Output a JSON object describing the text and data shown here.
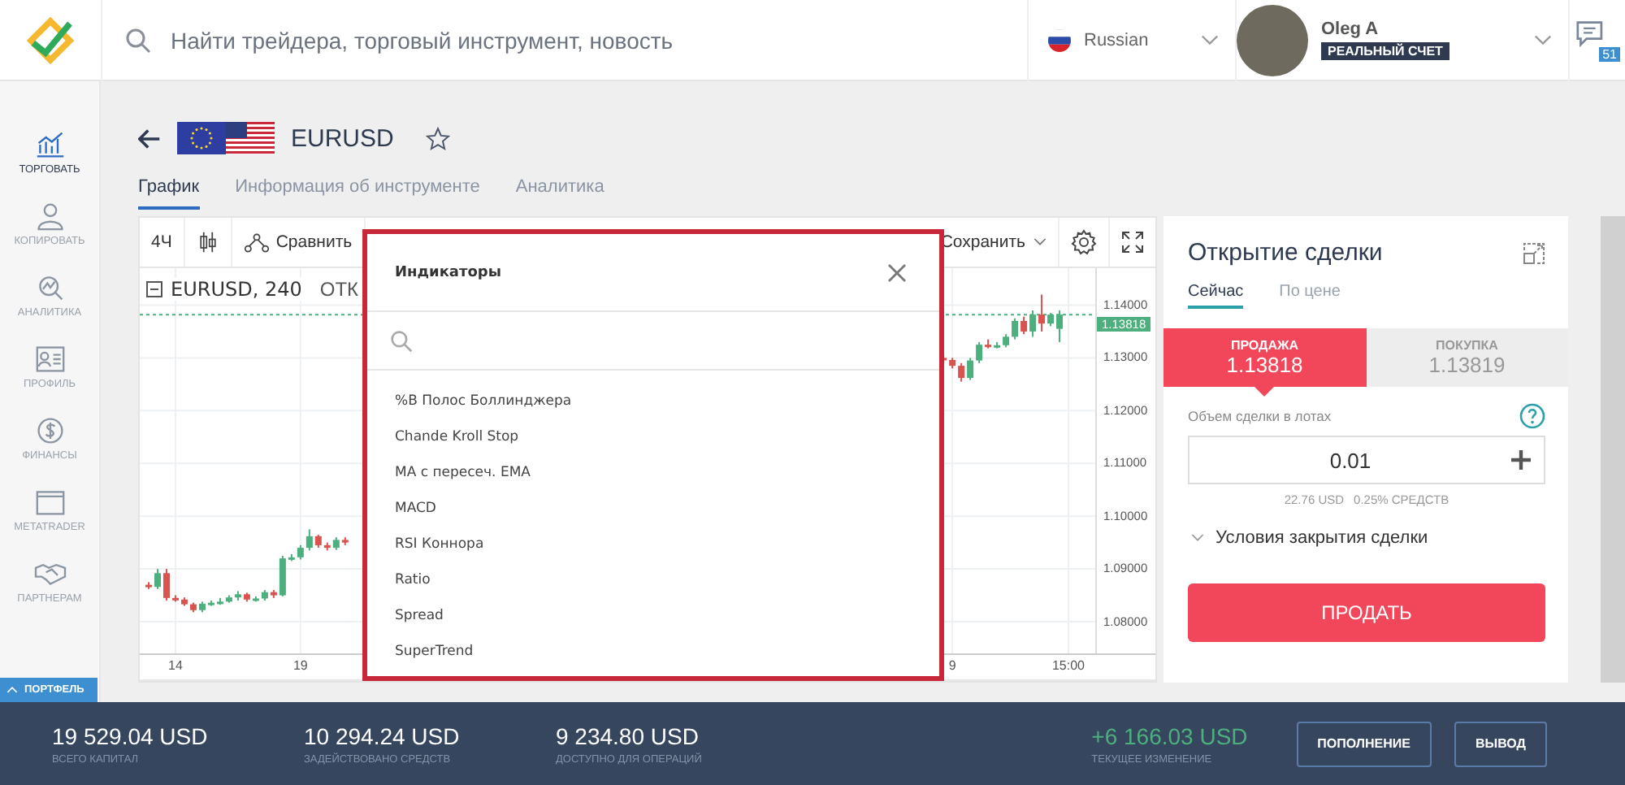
{
  "header": {
    "search": {
      "placeholder": "Найти трейдера, торговый инструмент, новость"
    },
    "language": "Russian",
    "user": {
      "name": "Oleg A",
      "account_badge": "РЕАЛЬНЫЙ СЧЕТ"
    },
    "messages_count": "51"
  },
  "sidebar": {
    "items": [
      {
        "label": "ТОРГОВАТЬ",
        "kind": "trade",
        "selected": true
      },
      {
        "label": "КОПИРОВАТЬ",
        "kind": "copy",
        "selected": false
      },
      {
        "label": "АНАЛИТИКА",
        "kind": "analytics",
        "selected": false
      },
      {
        "label": "ПРОФИЛЬ",
        "kind": "profile",
        "selected": false
      },
      {
        "label": "ФИНАНСЫ",
        "kind": "finance",
        "selected": false
      },
      {
        "label": "METATRADER",
        "kind": "window",
        "selected": false
      },
      {
        "label": "ПАРТНЕРАМ",
        "kind": "partners",
        "selected": false
      }
    ],
    "portfolio_tab": {
      "label": "ПОРТФЕЛЬ",
      "expanded": false
    }
  },
  "instrument": {
    "symbol": "EURUSD",
    "favorite": false
  },
  "tabs": [
    {
      "label": "График",
      "selected": true
    },
    {
      "label": "Информация об инструменте",
      "selected": false
    },
    {
      "label": "Аналитика",
      "selected": false
    }
  ],
  "chart": {
    "toolbar": {
      "interval": "4Ч",
      "compare": "Сравнить",
      "save": "Сохранить"
    },
    "legend": {
      "symbol": "EURUSD, 240",
      "extra": "ОТК"
    },
    "current_price": "1.13818",
    "chart_data": {
      "type": "candlestick",
      "ylim": [
        1.074,
        1.147
      ],
      "grid": true,
      "ref_lines": [
        {
          "axis": "y",
          "value": 1.13818
        }
      ],
      "yticks": [
        {
          "value": 1.14,
          "label": "1.14000"
        },
        {
          "value": 1.13,
          "label": "1.13000"
        },
        {
          "value": 1.12,
          "label": "1.12000"
        },
        {
          "value": 1.11,
          "label": "1.11000"
        },
        {
          "value": 1.1,
          "label": "1.10000"
        },
        {
          "value": 1.09,
          "label": "1.09000"
        },
        {
          "value": 1.08,
          "label": "1.08000"
        }
      ],
      "categories": [
        null,
        null,
        null,
        null,
        "14",
        null,
        null,
        null,
        null,
        null,
        null,
        null,
        null,
        null,
        null,
        null,
        null,
        null,
        "19",
        null,
        null,
        null,
        null,
        null,
        null,
        null,
        null,
        null,
        null,
        null,
        null,
        null,
        null,
        null,
        null,
        null,
        null,
        null,
        null,
        null,
        null,
        null,
        null,
        null,
        null,
        null,
        null,
        null,
        null,
        null,
        null,
        null,
        null,
        null,
        null,
        null,
        null,
        null,
        null,
        null,
        null,
        null,
        null,
        null,
        null,
        null,
        null,
        null,
        null,
        null,
        null,
        null,
        null,
        null,
        null,
        null,
        null,
        null,
        null,
        null,
        null,
        null,
        null,
        null,
        null,
        null,
        null,
        null,
        null,
        null,
        null,
        "9",
        null,
        null,
        null,
        null,
        null,
        null,
        null,
        null,
        null,
        null,
        null,
        null,
        "15:00",
        null,
        null
      ],
      "ohlc": [
        null,
        [
          1.087,
          1.0875,
          1.0862,
          1.0866
        ],
        [
          1.0866,
          1.09,
          1.0862,
          1.0892
        ],
        [
          1.0892,
          1.09,
          1.084,
          1.0845
        ],
        [
          1.0845,
          1.085,
          1.0838,
          1.0842
        ],
        [
          1.0842,
          1.0846,
          1.083,
          1.0833
        ],
        [
          1.0833,
          1.0836,
          1.0818,
          1.0822
        ],
        [
          1.0822,
          1.0838,
          1.0818,
          1.0834
        ],
        [
          1.0834,
          1.084,
          1.083,
          1.0836
        ],
        [
          1.0836,
          1.0845,
          1.0832,
          1.0838
        ],
        [
          1.0838,
          1.085,
          1.0836,
          1.0846
        ],
        [
          1.0846,
          1.0858,
          1.084,
          1.0852
        ],
        [
          1.0852,
          1.0855,
          1.0838,
          1.0842
        ],
        [
          1.0842,
          1.0848,
          1.0838,
          1.0844
        ],
        [
          1.0844,
          1.086,
          1.084,
          1.0856
        ],
        [
          1.0856,
          1.086,
          1.0845,
          1.085
        ],
        [
          1.085,
          1.0925,
          1.0848,
          1.092
        ],
        [
          1.092,
          1.0928,
          1.0915,
          1.0922
        ],
        [
          1.0922,
          1.0945,
          1.0918,
          1.094
        ],
        [
          1.094,
          1.0975,
          1.0935,
          1.0962
        ],
        [
          1.0962,
          1.0965,
          1.094,
          1.0945
        ],
        [
          1.0945,
          1.095,
          1.0935,
          1.094
        ],
        [
          1.094,
          1.096,
          1.0936,
          1.0955
        ],
        [
          1.0955,
          1.096,
          1.0945,
          1.095
        ],
        null,
        null,
        null,
        null,
        null,
        null,
        null,
        null,
        null,
        null,
        null,
        null,
        null,
        null,
        null,
        null,
        null,
        null,
        null,
        null,
        null,
        null,
        null,
        null,
        null,
        null,
        null,
        null,
        null,
        null,
        null,
        null,
        null,
        null,
        null,
        null,
        null,
        null,
        null,
        null,
        null,
        null,
        null,
        null,
        null,
        null,
        null,
        null,
        null,
        null,
        null,
        null,
        null,
        null,
        null,
        null,
        null,
        null,
        null,
        null,
        null,
        null,
        null,
        null,
        null,
        null,
        [
          1.13,
          1.1305,
          1.129,
          1.1296
        ],
        [
          1.1296,
          1.13,
          1.128,
          1.1285
        ],
        [
          1.1285,
          1.129,
          1.1255,
          1.1262
        ],
        [
          1.1262,
          1.13,
          1.1258,
          1.1295
        ],
        [
          1.1295,
          1.133,
          1.129,
          1.1325
        ],
        [
          1.1325,
          1.1335,
          1.1318,
          1.1322
        ],
        [
          1.1322,
          1.133,
          1.1318,
          1.1324
        ],
        [
          1.1324,
          1.1345,
          1.132,
          1.134
        ],
        [
          1.134,
          1.1375,
          1.1335,
          1.137
        ],
        [
          1.137,
          1.1378,
          1.1345,
          1.135
        ],
        [
          1.135,
          1.139,
          1.134,
          1.1382
        ],
        [
          1.1382,
          1.142,
          1.135,
          1.1365
        ],
        [
          1.1365,
          1.1385,
          1.136,
          1.1382
        ],
        [
          1.1355,
          1.139,
          1.133,
          1.1382
        ],
        null,
        null,
        null
      ]
    }
  },
  "indicators_dialog": {
    "title": "Индикаторы",
    "items": [
      "%B Полос Боллинджера",
      "Chande Kroll Stop",
      "MA с пересеч. EMA",
      "MACD",
      "RSI Коннора",
      "Ratio",
      "Spread",
      "SuperTrend"
    ]
  },
  "trade_panel": {
    "title": "Открытие сделки",
    "tabs": [
      {
        "label": "Сейчас",
        "selected": true
      },
      {
        "label": "По цене",
        "selected": false
      }
    ],
    "sides": [
      {
        "label": "ПРОДАЖА",
        "price": "1.13818",
        "selected": true
      },
      {
        "label": "ПОКУПКА",
        "price": "1.13819",
        "selected": false
      }
    ],
    "volume_label": "Объем сделки в лотах",
    "volume": "0.01",
    "cost": "22.76 USD",
    "share": "0.25% СРЕДСТВ",
    "close_conditions": {
      "label": "Условия закрытия сделки",
      "expanded": false
    },
    "submit": "ПРОДАТЬ"
  },
  "summary": {
    "stats": [
      {
        "value": "19 529.04 USD",
        "label": "ВСЕГО КАПИТАЛ",
        "kind": "plain"
      },
      {
        "value": "10 294.24 USD",
        "label": "ЗАДЕЙСТВОВАНО СРЕДСТВ",
        "kind": "plain"
      },
      {
        "value": "9 234.80 USD",
        "label": "ДОСТУПНО ДЛЯ ОПЕРАЦИЙ",
        "kind": "plain"
      },
      {
        "value": "+6 166.03 USD",
        "label": "ТЕКУЩЕЕ ИЗМЕНЕНИЕ",
        "kind": "change"
      }
    ],
    "buttons": [
      "ПОПОЛНЕНИЕ",
      "ВЫВОД"
    ]
  }
}
